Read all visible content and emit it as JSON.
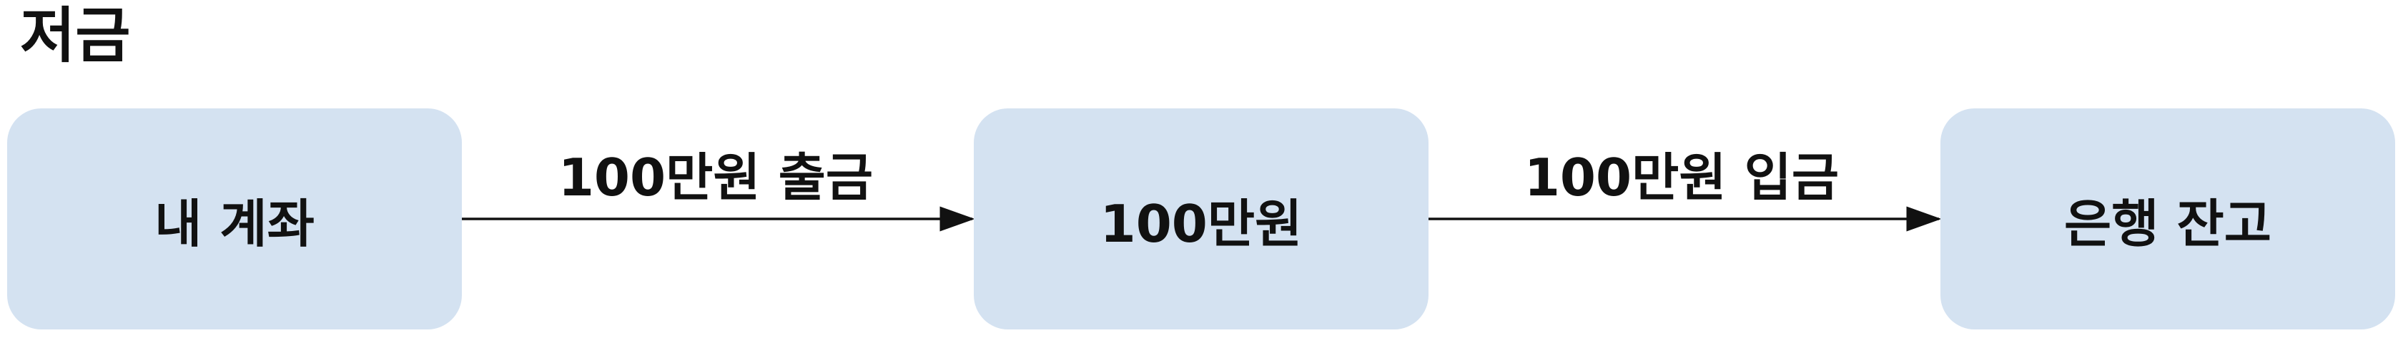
{
  "title": "저금",
  "colors": {
    "node_fill": "#d4e2f1",
    "edge_stroke": "#111111",
    "text": "#111111"
  },
  "nodes": [
    {
      "id": "my-account",
      "label": "내 계좌"
    },
    {
      "id": "amount",
      "label": "100만원"
    },
    {
      "id": "bank-balance",
      "label": "은행 잔고"
    }
  ],
  "edges": [
    {
      "from": "my-account",
      "to": "amount",
      "label": "100만원 출금"
    },
    {
      "from": "amount",
      "to": "bank-balance",
      "label": "100만원 입금"
    }
  ]
}
